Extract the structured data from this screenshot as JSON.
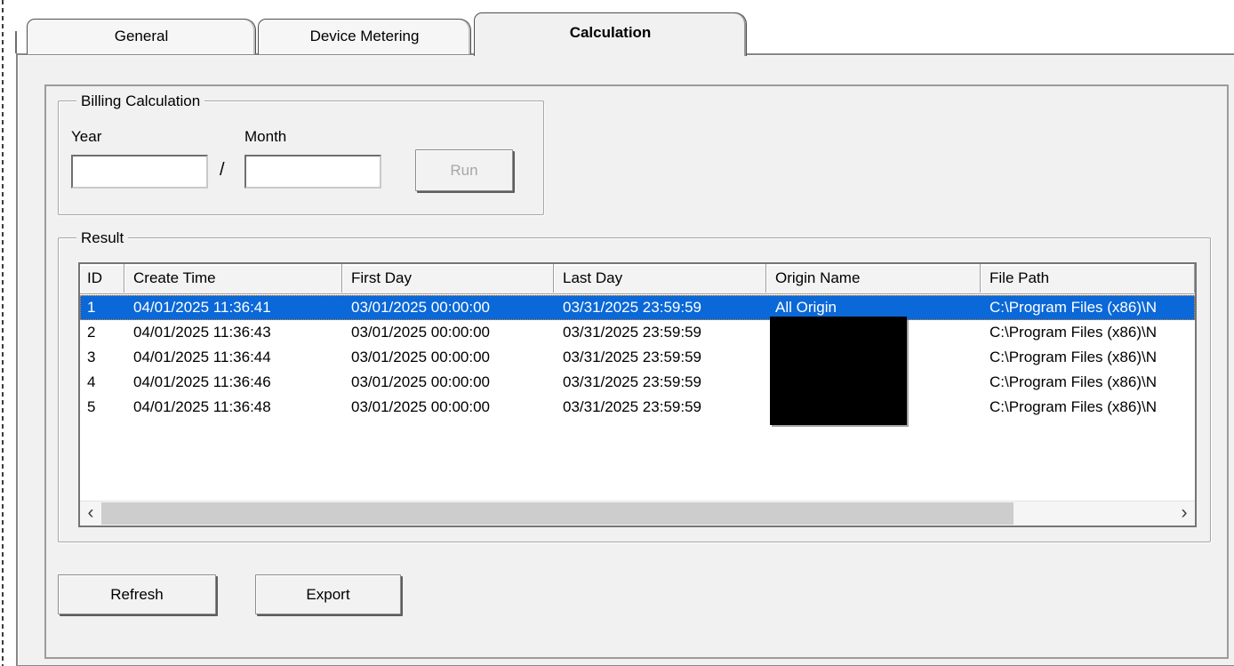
{
  "tabs": [
    {
      "label": "General",
      "active": false
    },
    {
      "label": "Device Metering",
      "active": false
    },
    {
      "label": "Calculation",
      "active": true
    }
  ],
  "billing": {
    "group_title": "Billing Calculation",
    "year_label": "Year",
    "year_value": "",
    "separator": "/",
    "month_label": "Month",
    "month_value": "",
    "run_label": "Run",
    "run_enabled": false
  },
  "result": {
    "group_title": "Result",
    "columns": [
      "ID",
      "Create Time",
      "First Day",
      "Last Day",
      "Origin Name",
      "File Path"
    ],
    "rows": [
      {
        "id": "1",
        "create_time": "04/01/2025 11:36:41",
        "first_day": "03/01/2025 00:00:00",
        "last_day": "03/31/2025 23:59:59",
        "origin_name": "All Origin",
        "file_path": "C:\\Program Files (x86)\\N",
        "selected": true,
        "redacted": false
      },
      {
        "id": "2",
        "create_time": "04/01/2025 11:36:43",
        "first_day": "03/01/2025 00:00:00",
        "last_day": "03/31/2025 23:59:59",
        "origin_name": "",
        "file_path": "C:\\Program Files (x86)\\N",
        "selected": false,
        "redacted": true
      },
      {
        "id": "3",
        "create_time": "04/01/2025 11:36:44",
        "first_day": "03/01/2025 00:00:00",
        "last_day": "03/31/2025 23:59:59",
        "origin_name": "",
        "file_path": "C:\\Program Files (x86)\\N",
        "selected": false,
        "redacted": true
      },
      {
        "id": "4",
        "create_time": "04/01/2025 11:36:46",
        "first_day": "03/01/2025 00:00:00",
        "last_day": "03/31/2025 23:59:59",
        "origin_name": "",
        "file_path": "C:\\Program Files (x86)\\N",
        "selected": false,
        "redacted": true
      },
      {
        "id": "5",
        "create_time": "04/01/2025 11:36:48",
        "first_day": "03/01/2025 00:00:00",
        "last_day": "03/31/2025 23:59:59",
        "origin_name": "",
        "file_path": "C:\\Program Files (x86)\\N",
        "selected": false,
        "redacted": true
      }
    ],
    "selected_id": "1"
  },
  "actions": {
    "refresh_label": "Refresh",
    "export_label": "Export"
  },
  "scrollbar": {
    "left_arrow": "‹",
    "right_arrow": "›"
  },
  "colors": {
    "selection_blue": "#0a68d8",
    "focus_orange": "#e0892a",
    "page_gray": "#f1f1f1",
    "redaction_black": "#000000"
  }
}
